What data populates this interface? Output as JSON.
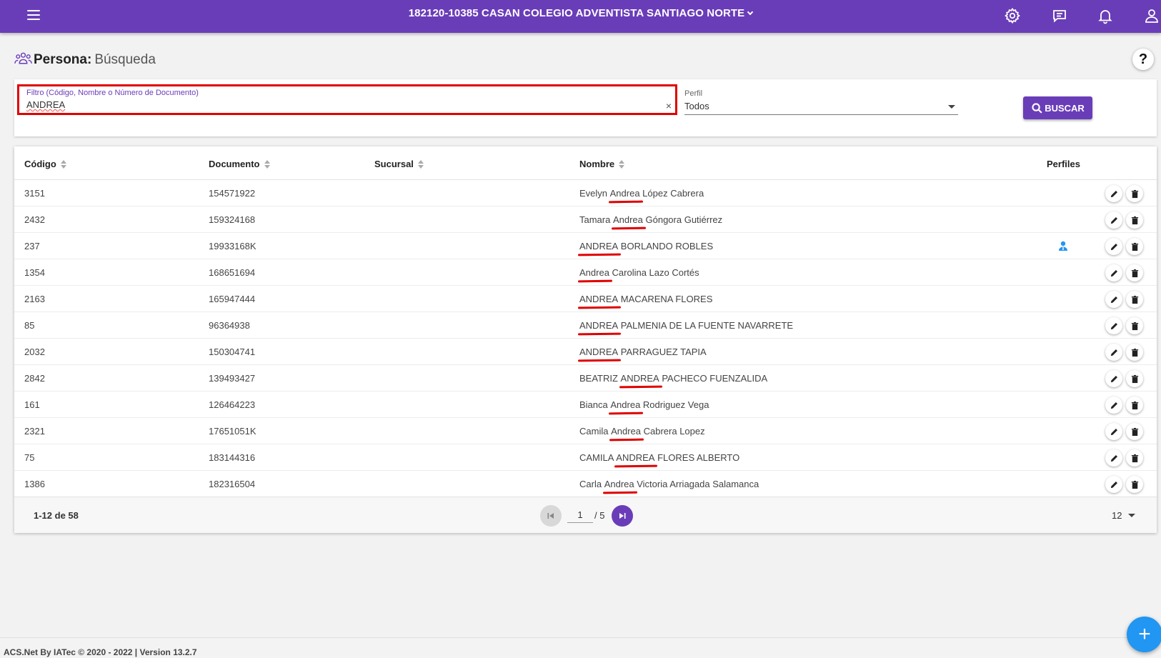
{
  "header": {
    "school_label": "182120-10385 CASAN COLEGIO ADVENTISTA SANTIAGO NORTE"
  },
  "page": {
    "title": "Persona:",
    "subtitle": "Búsqueda",
    "help_label": "?"
  },
  "filter": {
    "label": "Filtro (Código, Nombre o Número de Documento)",
    "value": "ANDREA",
    "clear_icon": "×",
    "perfil_label": "Perfil",
    "perfil_value": "Todos",
    "search_label": "BUSCAR"
  },
  "table": {
    "columns": [
      "Código",
      "Documento",
      "Sucursal",
      "Nombre",
      "Perfiles"
    ],
    "rows": [
      {
        "codigo": "3151",
        "documento": "154571922",
        "sucursal": "",
        "nombre_pre": "Evelyn ",
        "nombre_match": "Andrea",
        "nombre_post": " López Cabrera",
        "has_profile_icon": false
      },
      {
        "codigo": "2432",
        "documento": "159324168",
        "sucursal": "",
        "nombre_pre": "Tamara ",
        "nombre_match": "Andrea",
        "nombre_post": " Góngora Gutiérrez",
        "has_profile_icon": false
      },
      {
        "codigo": "237",
        "documento": "19933168K",
        "sucursal": "",
        "nombre_pre": "",
        "nombre_match": "ANDREA",
        "nombre_post": " BORLANDO ROBLES",
        "has_profile_icon": true
      },
      {
        "codigo": "1354",
        "documento": "168651694",
        "sucursal": "",
        "nombre_pre": "",
        "nombre_match": "Andrea",
        "nombre_post": " Carolina Lazo Cortés",
        "has_profile_icon": false
      },
      {
        "codigo": "2163",
        "documento": "165947444",
        "sucursal": "",
        "nombre_pre": "",
        "nombre_match": "ANDREA",
        "nombre_post": " MACARENA FLORES",
        "has_profile_icon": false
      },
      {
        "codigo": "85",
        "documento": "96364938",
        "sucursal": "",
        "nombre_pre": "",
        "nombre_match": "ANDREA",
        "nombre_post": " PALMENIA DE LA FUENTE NAVARRETE",
        "has_profile_icon": false
      },
      {
        "codigo": "2032",
        "documento": "150304741",
        "sucursal": "",
        "nombre_pre": "",
        "nombre_match": "ANDREA",
        "nombre_post": " PARRAGUEZ TAPIA",
        "has_profile_icon": false
      },
      {
        "codigo": "2842",
        "documento": "139493427",
        "sucursal": "",
        "nombre_pre": "BEATRIZ ",
        "nombre_match": "ANDREA",
        "nombre_post": " PACHECO FUENZALIDA",
        "has_profile_icon": false
      },
      {
        "codigo": "161",
        "documento": "126464223",
        "sucursal": "",
        "nombre_pre": "Bianca ",
        "nombre_match": "Andrea",
        "nombre_post": " Rodriguez Vega",
        "has_profile_icon": false
      },
      {
        "codigo": "2321",
        "documento": "17651051K",
        "sucursal": "",
        "nombre_pre": "Camila ",
        "nombre_match": "Andrea",
        "nombre_post": " Cabrera Lopez",
        "has_profile_icon": false
      },
      {
        "codigo": "75",
        "documento": "183144316",
        "sucursal": "",
        "nombre_pre": "CAMILA ",
        "nombre_match": "ANDREA",
        "nombre_post": " FLORES ALBERTO",
        "has_profile_icon": false
      },
      {
        "codigo": "1386",
        "documento": "182316504",
        "sucursal": "",
        "nombre_pre": "Carla ",
        "nombre_match": "Andrea",
        "nombre_post": " Victoria Arriagada Salamanca",
        "has_profile_icon": false
      }
    ]
  },
  "pagination": {
    "range": "1-12 de 58",
    "current_page": "1",
    "total_pages": "/ 5",
    "per_page": "12"
  },
  "footer": {
    "text": "ACS.Net By IATec © 2020 - 2022 | Version 13.2.7"
  },
  "fab": {
    "label": "+"
  },
  "colors": {
    "primary": "#6a3db8",
    "highlight": "#e00000",
    "fab": "#2196f3"
  }
}
